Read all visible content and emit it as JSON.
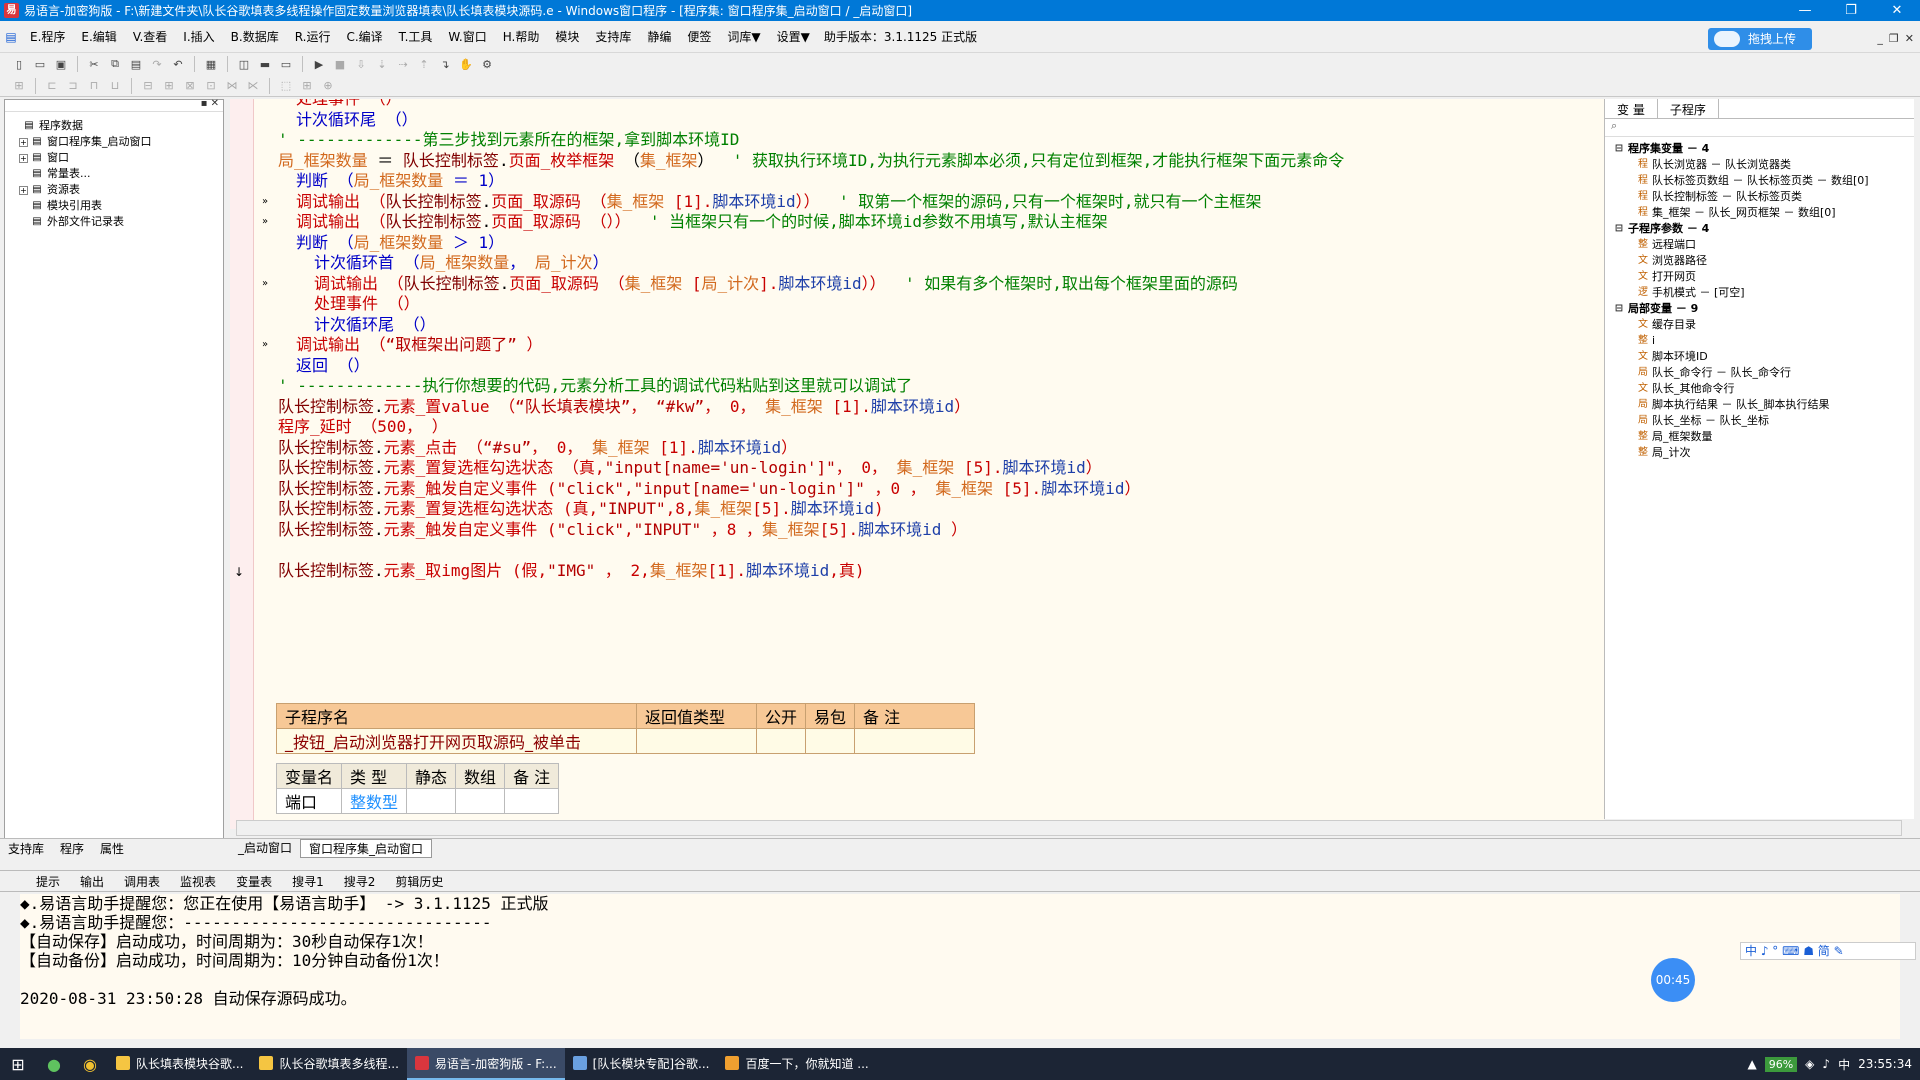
{
  "window": {
    "title": "易语言-加密狗版 - F:\\新建文件夹\\队长谷歌填表多线程操作固定数量浏览器填表\\队长填表模块源码.e - Windows窗口程序 - [程序集: 窗口程序集_启动窗口 / _启动窗口]"
  },
  "menu": [
    "E.程序",
    "E.编辑",
    "V.查看",
    "I.插入",
    "B.数据库",
    "R.运行",
    "C.编译",
    "T.工具",
    "W.窗口",
    "H.帮助",
    "模块",
    "支持库",
    "静编",
    "便签",
    "词库▼",
    "设置▼"
  ],
  "helper_version": "助手版本：3.1.1125 正式版",
  "upload_label": "拖拽上传",
  "left_tree": [
    {
      "label": "程序数据",
      "level": 0,
      "exp": ""
    },
    {
      "label": "窗口程序集_启动窗口",
      "level": 1,
      "exp": "+"
    },
    {
      "label": "窗口",
      "level": 1,
      "exp": "+"
    },
    {
      "label": "常量表...",
      "level": 1,
      "exp": ""
    },
    {
      "label": "资源表",
      "level": 1,
      "exp": "+"
    },
    {
      "label": "模块引用表",
      "level": 1,
      "exp": ""
    },
    {
      "label": "外部文件记录表",
      "level": 1,
      "exp": ""
    }
  ],
  "code_lines": [
    {
      "indent": 1,
      "parts": [
        [
          "ev",
          "处理事件 （）"
        ]
      ]
    },
    {
      "indent": 1,
      "parts": [
        [
          "kw",
          "计次循环尾 （）"
        ]
      ]
    },
    {
      "indent": 0,
      "parts": [
        [
          "cm",
          "' -------------第三步找到元素所在的框架,拿到脚本环境ID"
        ]
      ]
    },
    {
      "indent": 0,
      "parts": [
        [
          "var",
          "局_框架数量"
        ],
        [
          "gray",
          " ＝ "
        ],
        [
          "obj",
          "队长控制标签"
        ],
        [
          "gray",
          "."
        ],
        [
          "ev",
          "页面_枚举框架"
        ],
        [
          "gray",
          " （"
        ],
        [
          "var",
          "集_框架"
        ],
        [
          "gray",
          "）  "
        ],
        [
          "cm",
          "' 获取执行环境ID,为执行元素脚本必须,只有定位到框架,才能执行框架下面元素命令"
        ]
      ]
    },
    {
      "indent": 1,
      "parts": [
        [
          "kw",
          "判断 （"
        ],
        [
          "var",
          "局_框架数量"
        ],
        [
          "kw",
          " ＝ 1）"
        ]
      ]
    },
    {
      "indent": 1,
      "parts": [
        [
          "ev",
          "调试输出 （"
        ],
        [
          "obj",
          "队长控制标签"
        ],
        [
          "gray",
          "."
        ],
        [
          "ev",
          "页面_取源码 （"
        ],
        [
          "var",
          "集_框架"
        ],
        [
          "ev",
          " [1]."
        ],
        [
          "blue",
          "脚本环境id"
        ],
        [
          "ev",
          "））"
        ],
        [
          "cm",
          "  ' 取第一个框架的源码,只有一个框架时,就只有一个主框架"
        ]
      ]
    },
    {
      "indent": 1,
      "parts": [
        [
          "ev",
          "调试输出 （"
        ],
        [
          "obj",
          "队长控制标签"
        ],
        [
          "gray",
          "."
        ],
        [
          "ev",
          "页面_取源码 （））"
        ],
        [
          "cm",
          "  ' 当框架只有一个的时候,脚本环境id参数不用填写,默认主框架"
        ]
      ]
    },
    {
      "indent": 1,
      "parts": [
        [
          "kw",
          "判断 （"
        ],
        [
          "var",
          "局_框架数量"
        ],
        [
          "kw",
          " ＞ 1）"
        ]
      ]
    },
    {
      "indent": 2,
      "parts": [
        [
          "kw",
          "计次循环首 （"
        ],
        [
          "var",
          "局_框架数量"
        ],
        [
          "kw",
          "， "
        ],
        [
          "var",
          "局_计次"
        ],
        [
          "kw",
          "）"
        ]
      ]
    },
    {
      "indent": 2,
      "parts": [
        [
          "ev",
          "调试输出 （"
        ],
        [
          "obj",
          "队长控制标签"
        ],
        [
          "gray",
          "."
        ],
        [
          "ev",
          "页面_取源码 （"
        ],
        [
          "var",
          "集_框架"
        ],
        [
          "ev",
          " ["
        ],
        [
          "var",
          "局_计次"
        ],
        [
          "ev",
          "]."
        ],
        [
          "blue",
          "脚本环境id"
        ],
        [
          "ev",
          "））"
        ],
        [
          "cm",
          "  ' 如果有多个框架时,取出每个框架里面的源码"
        ]
      ]
    },
    {
      "indent": 2,
      "parts": [
        [
          "ev",
          "处理事件 （）"
        ]
      ]
    },
    {
      "indent": 2,
      "parts": [
        [
          "kw",
          "计次循环尾 （）"
        ]
      ]
    },
    {
      "indent": 1,
      "parts": [
        [
          "ev",
          "调试输出 （"
        ],
        [
          "str",
          "“取框架出问题了”"
        ],
        [
          "ev",
          " ）"
        ]
      ]
    },
    {
      "indent": 1,
      "parts": [
        [
          "kw",
          "返回 （）"
        ]
      ]
    },
    {
      "indent": 0,
      "parts": [
        [
          "cm",
          "' -------------执行你想要的代码,元素分析工具的调试代码粘贴到这里就可以调试了"
        ]
      ]
    },
    {
      "indent": 0,
      "parts": [
        [
          "obj",
          "队长控制标签"
        ],
        [
          "gray",
          "."
        ],
        [
          "ev",
          "元素_置value （"
        ],
        [
          "str",
          "“队长填表模块”"
        ],
        [
          "ev",
          "， "
        ],
        [
          "str",
          "“#kw”"
        ],
        [
          "ev",
          "， 0， "
        ],
        [
          "var",
          "集_框架"
        ],
        [
          "ev",
          " [1]."
        ],
        [
          "blue",
          "脚本环境id"
        ],
        [
          "ev",
          "）"
        ]
      ]
    },
    {
      "indent": 0,
      "parts": [
        [
          "ev",
          "程序_延时 （500， ）"
        ]
      ]
    },
    {
      "indent": 0,
      "parts": [
        [
          "obj",
          "队长控制标签"
        ],
        [
          "gray",
          "."
        ],
        [
          "ev",
          "元素_点击 （"
        ],
        [
          "str",
          "“#su”"
        ],
        [
          "ev",
          "， 0， "
        ],
        [
          "var",
          "集_框架"
        ],
        [
          "ev",
          " [1]."
        ],
        [
          "blue",
          "脚本环境id"
        ],
        [
          "ev",
          "）"
        ]
      ]
    },
    {
      "indent": 0,
      "parts": [
        [
          "obj",
          "队长控制标签"
        ],
        [
          "gray",
          "."
        ],
        [
          "ev",
          "元素_置复选框勾选状态 （真,"
        ],
        [
          "str",
          "\"input[name='un-login']\""
        ],
        [
          "ev",
          "， 0， "
        ],
        [
          "var",
          "集_框架"
        ],
        [
          "ev",
          " [5]."
        ],
        [
          "blue",
          "脚本环境id"
        ],
        [
          "ev",
          "）"
        ]
      ]
    },
    {
      "indent": 0,
      "parts": [
        [
          "obj",
          "队长控制标签"
        ],
        [
          "gray",
          "."
        ],
        [
          "ev",
          "元素_触发自定义事件 ("
        ],
        [
          "str",
          "\"click\""
        ],
        [
          "ev",
          ","
        ],
        [
          "str",
          "\"input[name='un-login']\""
        ],
        [
          "ev",
          " ，0 ， "
        ],
        [
          "var",
          "集_框架"
        ],
        [
          "ev",
          " [5]."
        ],
        [
          "blue",
          "脚本环境id"
        ],
        [
          "ev",
          "）"
        ]
      ]
    },
    {
      "indent": 0,
      "parts": [
        [
          "obj",
          "队长控制标签"
        ],
        [
          "gray",
          "."
        ],
        [
          "ev",
          "元素_置复选框勾选状态 (真,"
        ],
        [
          "str",
          "\"INPUT\""
        ],
        [
          "ev",
          ",8,"
        ],
        [
          "var",
          "集_框架"
        ],
        [
          "ev",
          "[5]."
        ],
        [
          "blue",
          "脚本环境id"
        ],
        [
          "ev",
          ")"
        ]
      ]
    },
    {
      "indent": 0,
      "parts": [
        [
          "obj",
          "队长控制标签"
        ],
        [
          "gray",
          "."
        ],
        [
          "ev",
          "元素_触发自定义事件 ("
        ],
        [
          "str",
          "\"click\""
        ],
        [
          "ev",
          ","
        ],
        [
          "str",
          "\"INPUT\""
        ],
        [
          "ev",
          " ，8 ，"
        ],
        [
          "var",
          "集_框架"
        ],
        [
          "ev",
          "[5]."
        ],
        [
          "blue",
          "脚本环境id"
        ],
        [
          "ev",
          " ）"
        ]
      ]
    },
    {
      "indent": 0,
      "parts": []
    },
    {
      "indent": 0,
      "parts": [
        [
          "obj",
          "队长控制标签"
        ],
        [
          "gray",
          "."
        ],
        [
          "ev",
          "元素_取img图片 (假,"
        ],
        [
          "str",
          "\"IMG\""
        ],
        [
          "ev",
          " ， 2,"
        ],
        [
          "var",
          "集_框架"
        ],
        [
          "ev",
          "[1]."
        ],
        [
          "blue",
          "脚本环境id"
        ],
        [
          "ev",
          ",真)"
        ]
      ]
    }
  ],
  "sub_table": {
    "headers": [
      "子程序名",
      "返回值类型",
      "公开",
      "易包",
      "备 注"
    ],
    "row": [
      "_按钮_启动浏览器打开网页取源码_被单击",
      "",
      "",
      "",
      ""
    ]
  },
  "var_table": {
    "headers": [
      "变量名",
      "类 型",
      "静态",
      "数组",
      "备 注"
    ],
    "row": [
      "端口",
      "整数型",
      "",
      "",
      ""
    ]
  },
  "right_tabs": [
    "变 量",
    "子程序"
  ],
  "var_tree": [
    {
      "label": "程序集变量 － 4",
      "level": 0,
      "bold": true,
      "t": "-"
    },
    {
      "label": "队长浏览器 － 队长浏览器类",
      "level": 1,
      "t": "程"
    },
    {
      "label": "队长标签页数组 － 队长标签页类 － 数组[0]",
      "level": 1,
      "t": "程"
    },
    {
      "label": "队长控制标签 － 队长标签页类",
      "level": 1,
      "t": "程"
    },
    {
      "label": "集_框架 － 队长_网页框架 － 数组[0]",
      "level": 1,
      "t": "程"
    },
    {
      "label": "子程序参数 － 4",
      "level": 0,
      "bold": true,
      "t": "-"
    },
    {
      "label": "远程端口",
      "level": 1,
      "t": "整"
    },
    {
      "label": "浏览器路径",
      "level": 1,
      "t": "文"
    },
    {
      "label": "打开网页",
      "level": 1,
      "t": "文"
    },
    {
      "label": "手机模式 － [可空]",
      "level": 1,
      "t": "逻"
    },
    {
      "label": "局部变量 － 9",
      "level": 0,
      "bold": true,
      "t": "-"
    },
    {
      "label": "缓存目录",
      "level": 1,
      "t": "文"
    },
    {
      "label": "i",
      "level": 1,
      "t": "整"
    },
    {
      "label": "脚本环境ID",
      "level": 1,
      "t": "文"
    },
    {
      "label": "队长_命令行 － 队长_命令行",
      "level": 1,
      "t": "局"
    },
    {
      "label": "队长_其他命令行",
      "level": 1,
      "t": "文"
    },
    {
      "label": "脚本执行结果 － 队长_脚本执行结果",
      "level": 1,
      "t": "局"
    },
    {
      "label": "队长_坐标 － 队长_坐标",
      "level": 1,
      "t": "局"
    },
    {
      "label": "局_框架数量",
      "level": 1,
      "t": "整"
    },
    {
      "label": "局_计次",
      "level": 1,
      "t": "整"
    }
  ],
  "bottom_left_tabs": [
    "支持库",
    "程序",
    "属性"
  ],
  "editor_tabs": [
    "_启动窗口",
    "窗口程序集_启动窗口"
  ],
  "output_tabs": [
    "提示",
    "输出",
    "调用表",
    "监视表",
    "变量表",
    "搜寻1",
    "搜寻2",
    "剪辑历史"
  ],
  "output_lines": [
    "◆.易语言助手提醒您：您正在使用【易语言助手】 -> 3.1.1125 正式版",
    "◆.易语言助手提醒您：--------------------------------",
    "【自动保存】启动成功，时间周期为：30秒自动保存1次！",
    "【自动备份】启动成功，时间周期为：10分钟自动备份1次！",
    "",
    "2020-08-31 23:50:28 自动保存源码成功。"
  ],
  "timer_label": "00:45",
  "ime_label": "中 ♪ ° ⌨ ☗ 简 ✎",
  "taskbar": {
    "apps": [
      {
        "label": "队长填表模块谷歌...",
        "color": "#f5c542",
        "active": false
      },
      {
        "label": "队长谷歌填表多线程...",
        "color": "#f5c542",
        "active": false
      },
      {
        "label": "易语言-加密狗版 - F:...",
        "color": "#d9363e",
        "active": true
      },
      {
        "label": "[队长模块专配]谷歌...",
        "color": "#6aa0e0",
        "active": false
      },
      {
        "label": "百度一下，你就知道 ...",
        "color": "#f0a030",
        "active": false
      }
    ],
    "battery": "96%",
    "ime": "中",
    "clock": "23:55:34"
  },
  "colors": {
    "accent": "#0078d7",
    "editor_bg": "#fffbf0",
    "comment": "#008000"
  }
}
